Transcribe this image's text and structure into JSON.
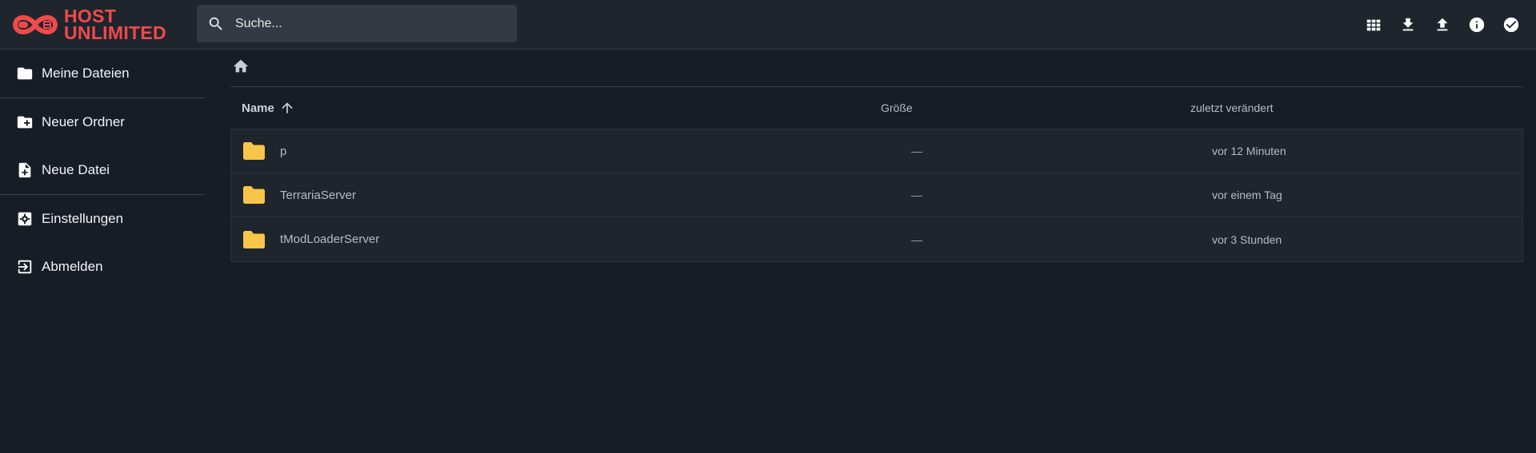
{
  "brand": {
    "line1": "HOST",
    "line2": "UNLIMITED",
    "color": "#f04a4a"
  },
  "search": {
    "placeholder": "Suche..."
  },
  "header_actions": [
    {
      "name": "grid-view-icon"
    },
    {
      "name": "download-icon"
    },
    {
      "name": "upload-icon"
    },
    {
      "name": "info-icon"
    },
    {
      "name": "select-check-icon"
    }
  ],
  "sidebar": {
    "items": [
      {
        "label": "Meine Dateien",
        "icon": "folder-icon"
      },
      {
        "label": "Neuer Ordner",
        "icon": "new-folder-icon"
      },
      {
        "label": "Neue Datei",
        "icon": "new-file-icon"
      },
      {
        "label": "Einstellungen",
        "icon": "settings-icon"
      },
      {
        "label": "Abmelden",
        "icon": "logout-icon"
      }
    ]
  },
  "breadcrumb": {
    "icon": "home-icon"
  },
  "table": {
    "headers": {
      "name": "Name",
      "size": "Größe",
      "modified": "zuletzt verändert"
    },
    "sort": {
      "column": "name",
      "direction": "ascending"
    },
    "rows": [
      {
        "name": "p",
        "size": "—",
        "modified": "vor 12 Minuten"
      },
      {
        "name": "TerrariaServer",
        "size": "—",
        "modified": "vor einem Tag"
      },
      {
        "name": "tModLoaderServer",
        "size": "—",
        "modified": "vor 3 Stunden"
      }
    ]
  },
  "colors": {
    "folder": "#f7c548",
    "background": "#171d25",
    "header": "#1f252d"
  }
}
